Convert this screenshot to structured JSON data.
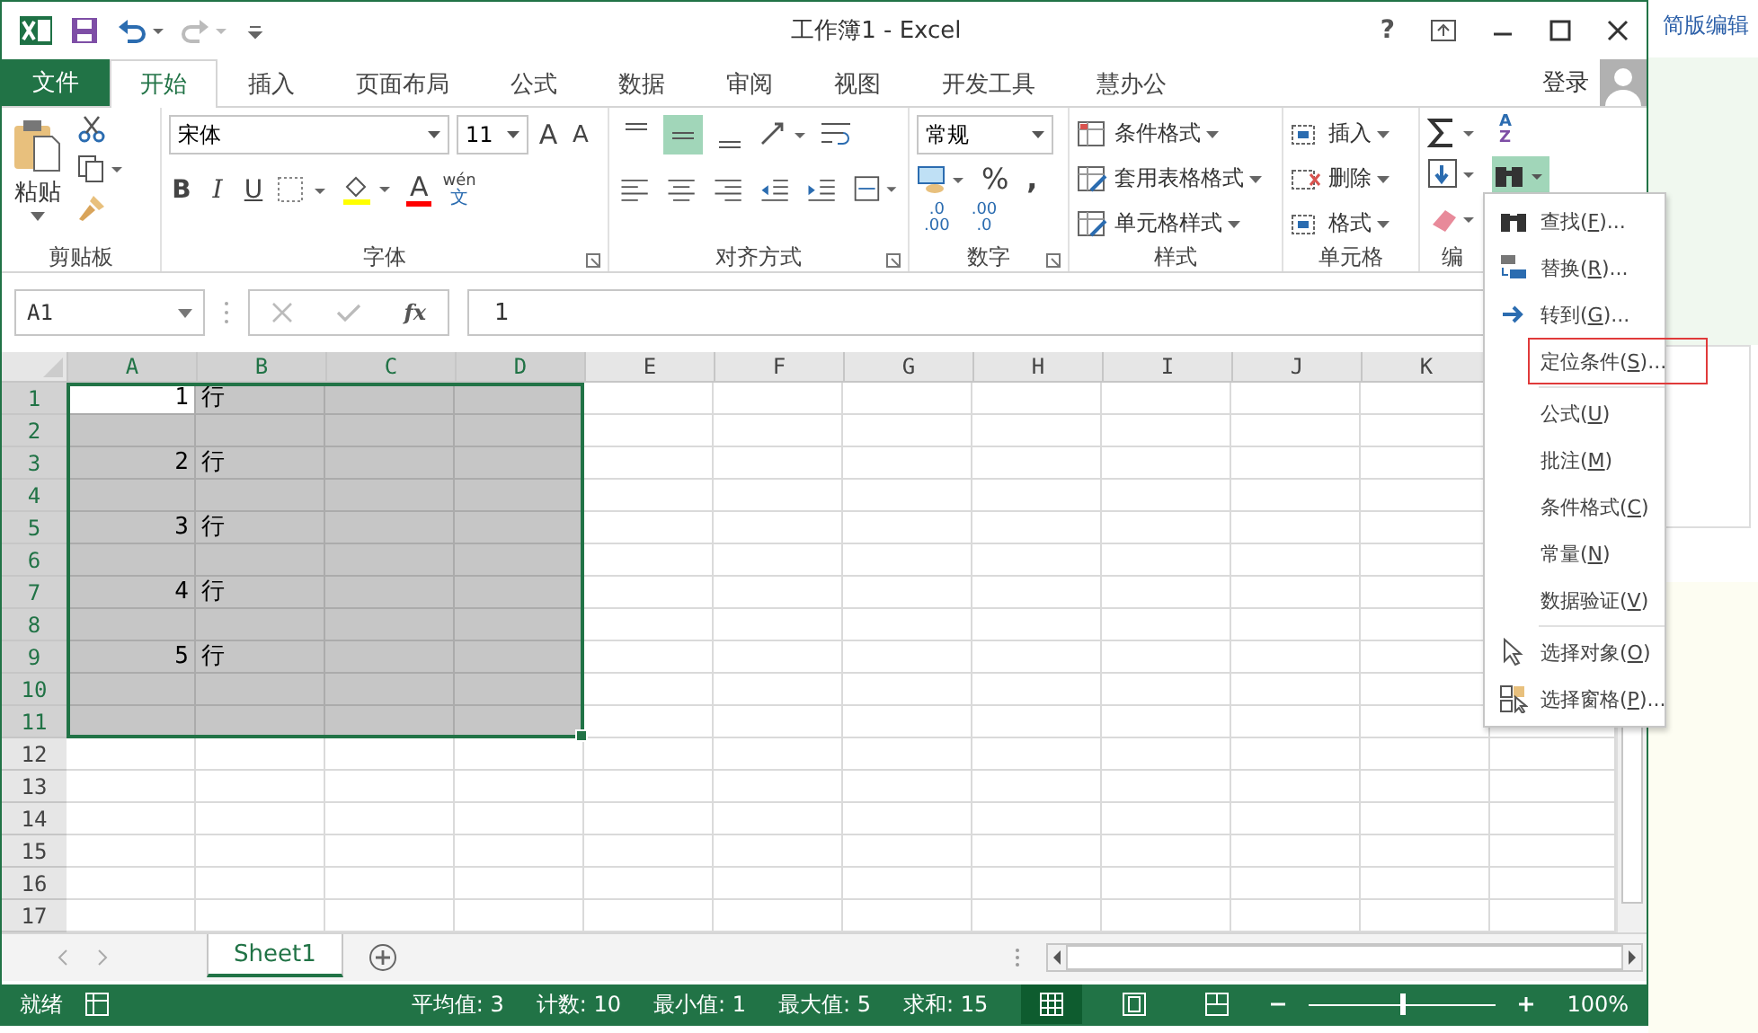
{
  "window": {
    "title": "工作簿1 - Excel",
    "help": "?"
  },
  "tabs": [
    {
      "label": "文件",
      "kind": "file",
      "selected": false
    },
    {
      "label": "开始",
      "kind": "tab",
      "selected": true
    },
    {
      "label": "插入",
      "kind": "tab",
      "selected": false
    },
    {
      "label": "页面布局",
      "kind": "tab",
      "selected": false
    },
    {
      "label": "公式",
      "kind": "tab",
      "selected": false
    },
    {
      "label": "数据",
      "kind": "tab",
      "selected": false
    },
    {
      "label": "审阅",
      "kind": "tab",
      "selected": false
    },
    {
      "label": "视图",
      "kind": "tab",
      "selected": false
    },
    {
      "label": "开发工具",
      "kind": "tab",
      "selected": false
    },
    {
      "label": "慧办公",
      "kind": "tab",
      "selected": false
    }
  ],
  "account": {
    "label": "登录"
  },
  "clipboard": {
    "label": "剪贴板",
    "paste": "粘贴"
  },
  "font": {
    "label": "字体",
    "name": "宋体",
    "size": "11",
    "grow": "A",
    "shrink": "A",
    "bold": "B",
    "italic": "I",
    "underline": "U",
    "font_color": "A",
    "phonetic": "wén",
    "phonetic_base": "文"
  },
  "alignment": {
    "label": "对齐方式",
    "vertical": [
      {
        "selected": false
      },
      {
        "selected": true
      },
      {
        "selected": false
      }
    ]
  },
  "number": {
    "label": "数字",
    "format": "常规",
    "percent": "%",
    "comma": ",",
    "decimals": [
      {
        "top": ".0",
        "bottom": ".00"
      },
      {
        "top": ".00",
        "bottom": ".0"
      }
    ]
  },
  "styles": {
    "label": "样式",
    "items": [
      "条件格式",
      "套用表格格式",
      "单元格样式"
    ]
  },
  "cells": {
    "label": "单元格",
    "items": [
      "插入",
      "删除",
      "格式"
    ]
  },
  "editing": {
    "label": "编",
    "sort": [
      "A",
      "Z"
    ],
    "find_open": true
  },
  "formula_bar": {
    "name_box": "A1",
    "fx": "fx",
    "value": "1"
  },
  "sheet": {
    "columns": [
      {
        "label": "A",
        "selected": true
      },
      {
        "label": "B",
        "selected": true
      },
      {
        "label": "C",
        "selected": true
      },
      {
        "label": "D",
        "selected": true
      },
      {
        "label": "E",
        "selected": false
      },
      {
        "label": "F",
        "selected": false
      },
      {
        "label": "G",
        "selected": false
      },
      {
        "label": "H",
        "selected": false
      },
      {
        "label": "I",
        "selected": false
      },
      {
        "label": "J",
        "selected": false
      },
      {
        "label": "K",
        "selected": false
      }
    ],
    "rows": [
      {
        "label": "1",
        "selected": true,
        "active": true,
        "cells": [
          "1",
          "行"
        ]
      },
      {
        "label": "2",
        "selected": true,
        "active": false
      },
      {
        "label": "3",
        "selected": true,
        "active": false,
        "cells": [
          "2",
          "行"
        ]
      },
      {
        "label": "4",
        "selected": true,
        "active": false
      },
      {
        "label": "5",
        "selected": true,
        "active": false,
        "cells": [
          "3",
          "行"
        ]
      },
      {
        "label": "6",
        "selected": true,
        "active": false
      },
      {
        "label": "7",
        "selected": true,
        "active": false,
        "cells": [
          "4",
          "行"
        ]
      },
      {
        "label": "8",
        "selected": true,
        "active": false
      },
      {
        "label": "9",
        "selected": true,
        "active": false,
        "cells": [
          "5",
          "行"
        ]
      },
      {
        "label": "10",
        "selected": true,
        "active": false
      },
      {
        "label": "11",
        "selected": true,
        "active": false
      },
      {
        "label": "12",
        "selected": false
      },
      {
        "label": "13",
        "selected": false
      },
      {
        "label": "14",
        "selected": false
      },
      {
        "label": "15",
        "selected": false
      },
      {
        "label": "16",
        "selected": false
      },
      {
        "label": "17",
        "selected": false
      }
    ]
  },
  "sheet_tabs": [
    {
      "label": "Sheet1",
      "selected": true
    }
  ],
  "status_bar": {
    "ready": "就绪",
    "stats": [
      "平均值: 3",
      "计数: 10",
      "最小值: 1",
      "最大值: 5",
      "求和: 15"
    ],
    "views": [
      {
        "selected": true
      },
      {
        "selected": false
      },
      {
        "selected": false
      }
    ],
    "zoom_slider": {
      "level": 0.5
    },
    "zoom": "100%"
  },
  "menu": {
    "items": [
      {
        "kind": "find",
        "before": "查找(",
        "key": "F",
        "after": ")...",
        "highlighted": false,
        "separator_after": false
      },
      {
        "kind": "replace",
        "before": "替换(",
        "key": "R",
        "after": ")...",
        "highlighted": false,
        "separator_after": false
      },
      {
        "kind": "goto",
        "before": "转到(",
        "key": "G",
        "after": ")...",
        "highlighted": false,
        "separator_after": false
      },
      {
        "kind": "plain",
        "before": "定位条件(",
        "key": "S",
        "after": ")...",
        "highlighted": true,
        "separator_after": true
      },
      {
        "kind": "plain",
        "before": "公式(",
        "key": "U",
        "after": ")",
        "highlighted": false,
        "separator_after": false
      },
      {
        "kind": "plain",
        "before": "批注(",
        "key": "M",
        "after": ")",
        "highlighted": false,
        "separator_after": false
      },
      {
        "kind": "plain",
        "before": "条件格式(",
        "key": "C",
        "after": ")",
        "highlighted": false,
        "separator_after": false
      },
      {
        "kind": "plain",
        "before": "常量(",
        "key": "N",
        "after": ")",
        "highlighted": false,
        "separator_after": false
      },
      {
        "kind": "plain",
        "before": "数据验证(",
        "key": "V",
        "after": ")",
        "highlighted": false,
        "separator_after": true
      },
      {
        "kind": "select",
        "before": "选择对象(",
        "key": "O",
        "after": ")",
        "highlighted": false,
        "separator_after": false
      },
      {
        "kind": "pane",
        "before": "选择窗格(",
        "key": "P",
        "after": ")...",
        "highlighted": false,
        "separator_after": false
      }
    ]
  },
  "backdrop": {
    "link": "简版编辑"
  }
}
